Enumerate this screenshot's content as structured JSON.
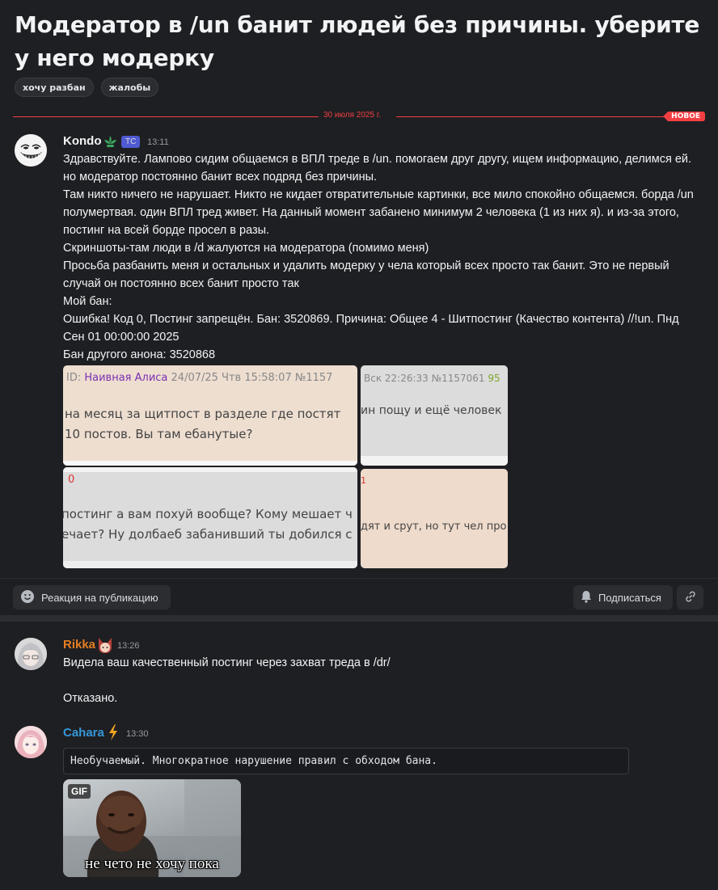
{
  "thread": {
    "title": "Модератор в /un банит людей без причины. уберите у него модерку",
    "tags": [
      "хочу разбан",
      "жалобы"
    ]
  },
  "divider": {
    "date": "30 июля 2025 г.",
    "new_label": "НОВОЕ"
  },
  "messages": [
    {
      "author": "Kondo",
      "author_color": "#f2f3f5",
      "badge": "ТС",
      "time": "13:11",
      "lines": [
        "Здравствуйте. Лампово сидим общаемся в ВПЛ треде в /un. помогаем друг другу, ищем информацию, делимся ей. но модератор постоянно банит всех подряд без причины.",
        "Там никто ничего не нарушает. Никто не кидает отвратительные картинки, все мило спокойно общаемся. борда /un полумертвая. один ВПЛ тред живет. На данный момент забанено минимум 2 человека (1 из них я). и из-за этого, постинг на всей борде просел в разы.",
        "Скриншоты-там люди в /d жалуются на модератора (помимо меня)",
        "Просьба разбанить меня и остальных и удалить модерку у чела который всех просто так банит. Это не первый случай он постоянно всех банит просто так",
        "Мой бан:",
        "Ошибка! Код 0, Постинг запрещён. Бан: 3520869. Причина: Общее 4 - Шитпостинг (Качество контента) //!un. Пнд Сен 01 00:00:00 2025",
        "Бан другого анона: 3520868"
      ],
      "screenshots": {
        "s1_header_id": "ID: ",
        "s1_header_name": "Наивная Алиса",
        "s1_header_meta": " 24/07/25 Чтв 15:58:07 №1157",
        "s1_text": [
          "на месяц за щитпост в разделе где постят",
          "10 постов. Вы там ебанутые?"
        ],
        "s2_header": "Вск 22:26:33 №1157061 ",
        "s2_header_num": "95",
        "s2_text": "ин пощу и ещё человек",
        "s3_num": "0",
        "s3_text": [
          "постинг а вам похуй вообще? Кому мешает ч",
          "ечает? Ну долбаеб забанивший ты добился с"
        ],
        "s4_num": "1",
        "s4_text": "дят и срут, но тут чел про"
      }
    },
    {
      "author": "Rikka",
      "author_color": "#e67e22",
      "time": "13:26",
      "lines": [
        "Видела ваш качественный постинг через захват треда в /dr/",
        "",
        "Отказано."
      ]
    },
    {
      "author": "Cahara",
      "author_color": "#3498db",
      "time": "13:30",
      "code": "Необучаемый. Многократное нарушение правил с обходом бана.",
      "gif": {
        "badge": "GIF",
        "caption": "не чето не хочу пока"
      }
    }
  ],
  "actions": {
    "react_label": "Реакция на публикацию",
    "subscribe_label": "Подписаться"
  }
}
